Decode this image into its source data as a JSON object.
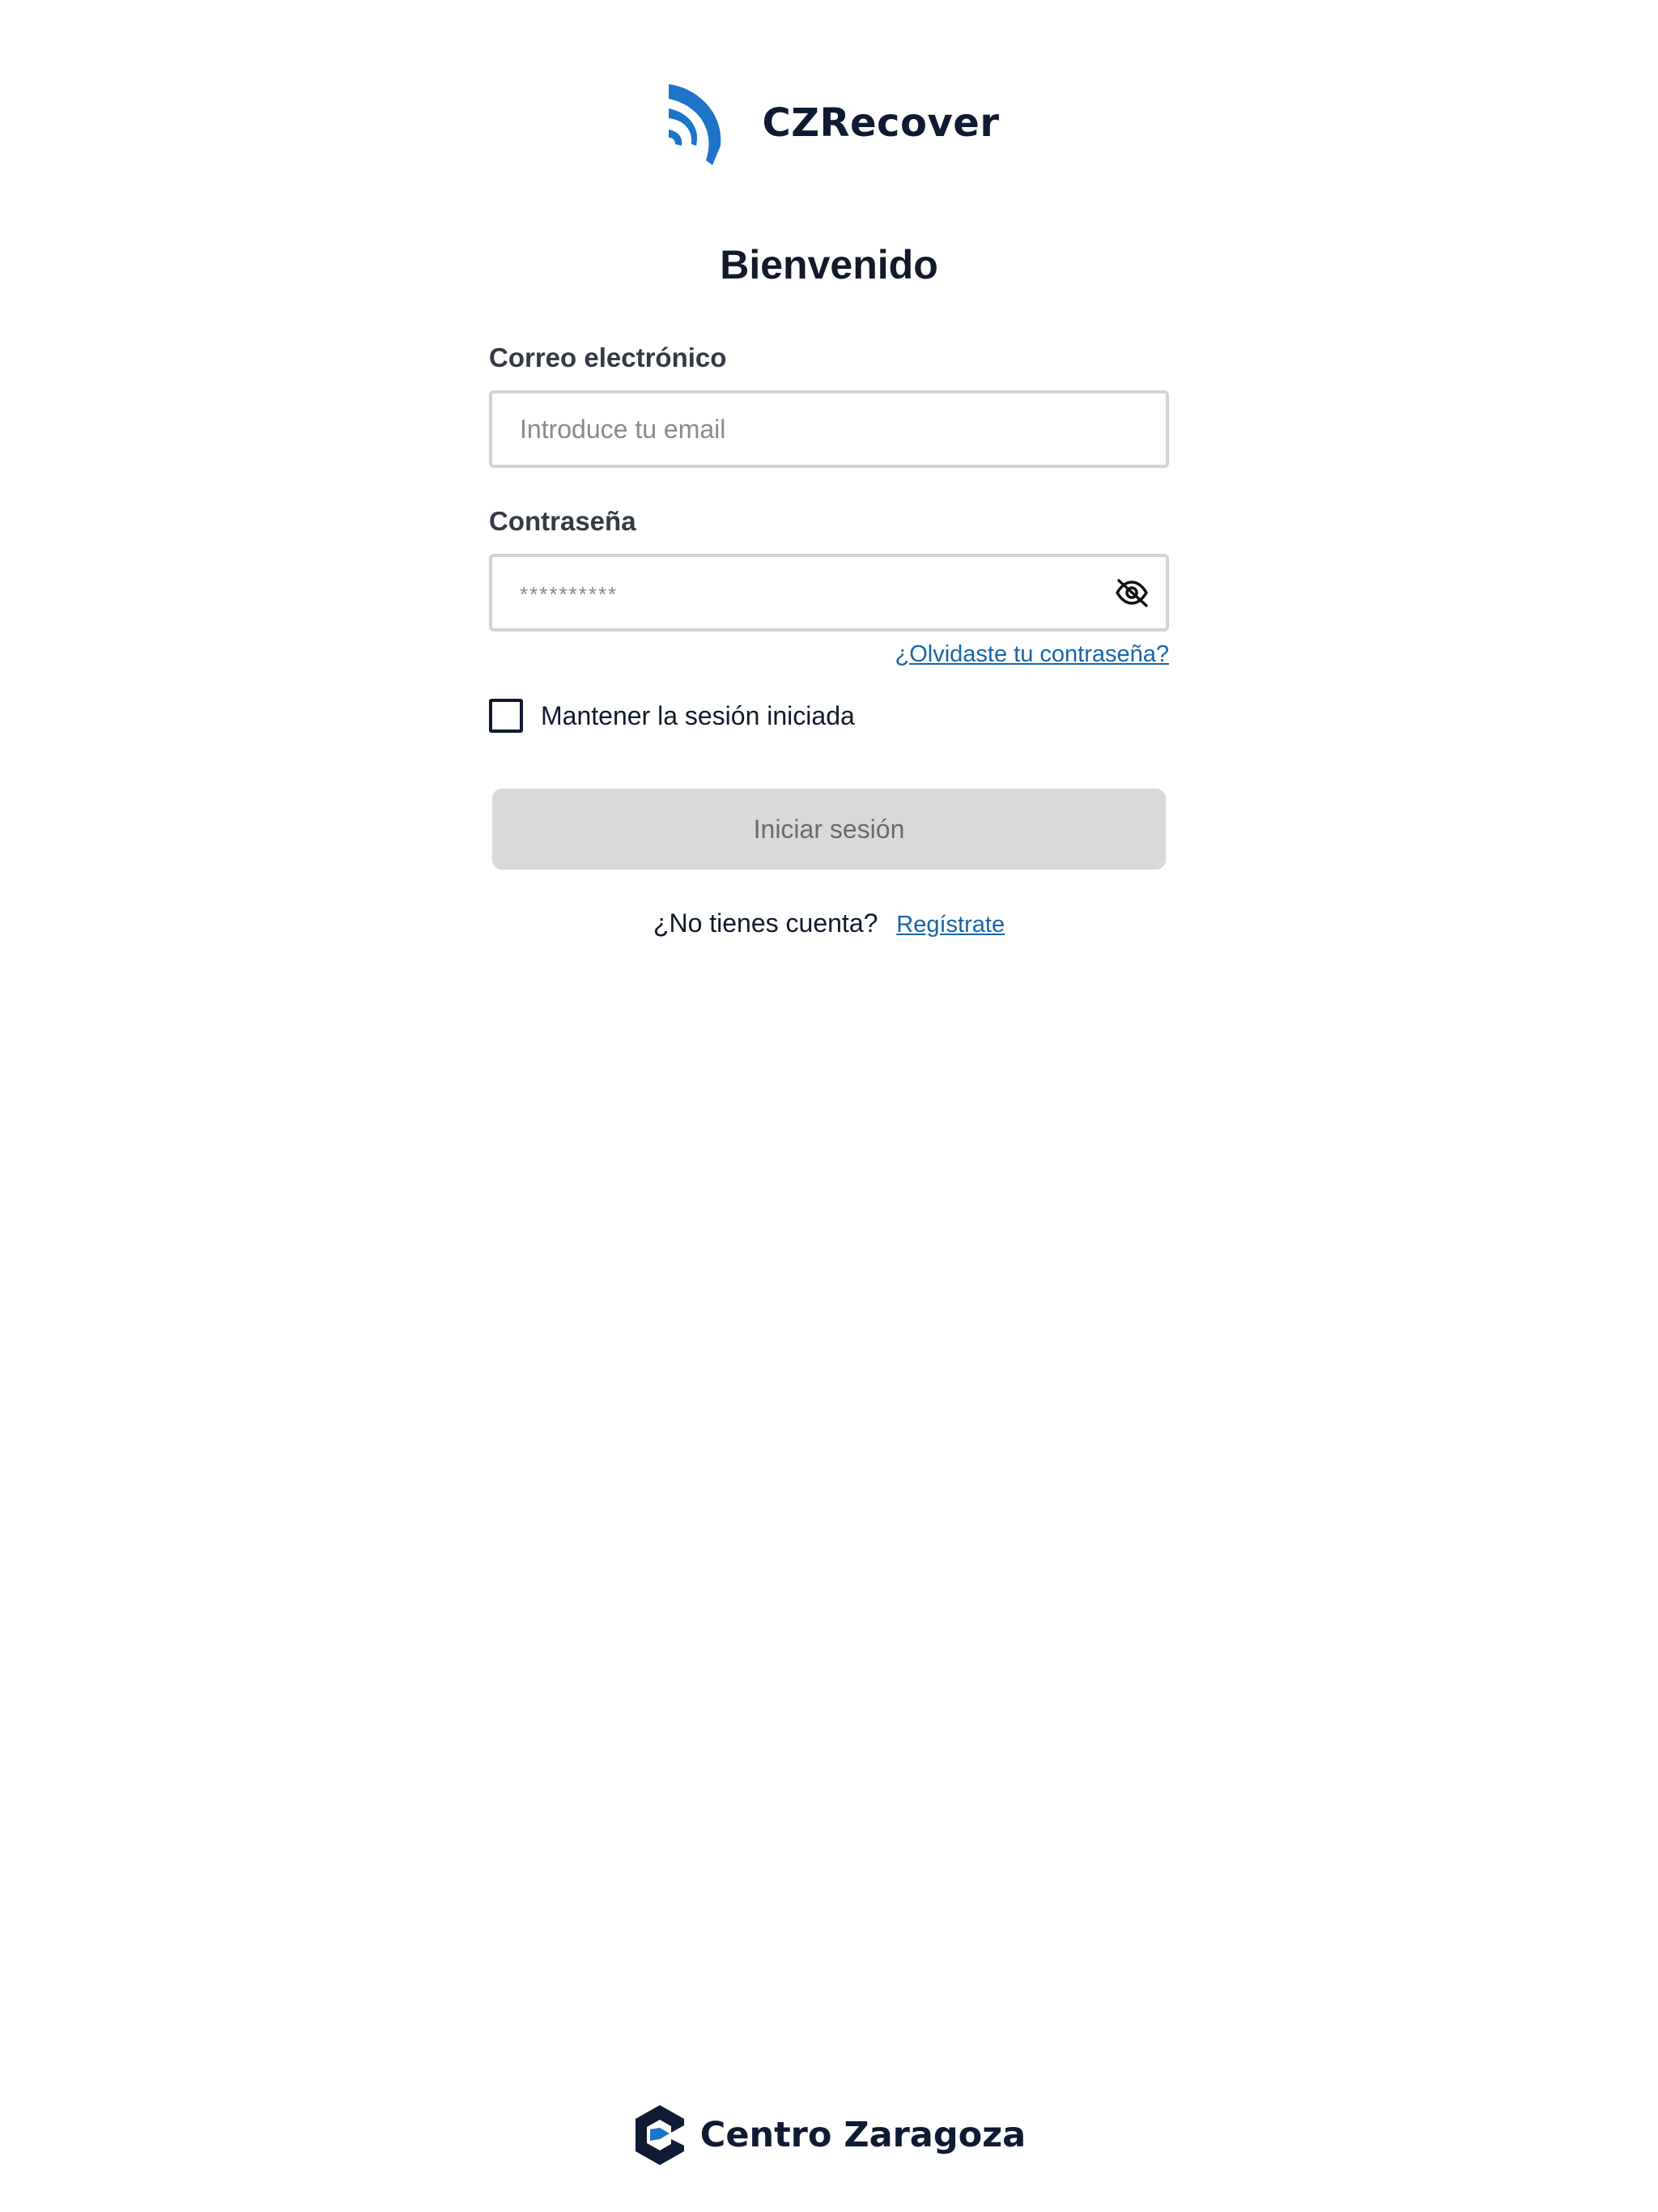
{
  "app": {
    "name": "CZRecover"
  },
  "login": {
    "title": "Bienvenido",
    "email_label": "Correo electrónico",
    "email_placeholder": "Introduce tu email",
    "email_value": "",
    "password_label": "Contraseña",
    "password_placeholder": "**********",
    "password_value": "",
    "toggle_password_icon": "eye-slash-icon",
    "forgot_link": "¿Olvidaste tu contraseña?",
    "remember_label": "Mantener la sesión iniciada",
    "remember_checked": false,
    "submit_label": "Iniciar sesión",
    "signup_prompt": "¿No tienes cuenta?",
    "signup_link": "Regístrate"
  },
  "footer": {
    "company": "Centro Zaragoza"
  },
  "colors": {
    "brand_blue": "#1d74c9",
    "navy": "#0f1a33",
    "link": "#1765a8",
    "button_disabled": "#d9d9d9"
  }
}
